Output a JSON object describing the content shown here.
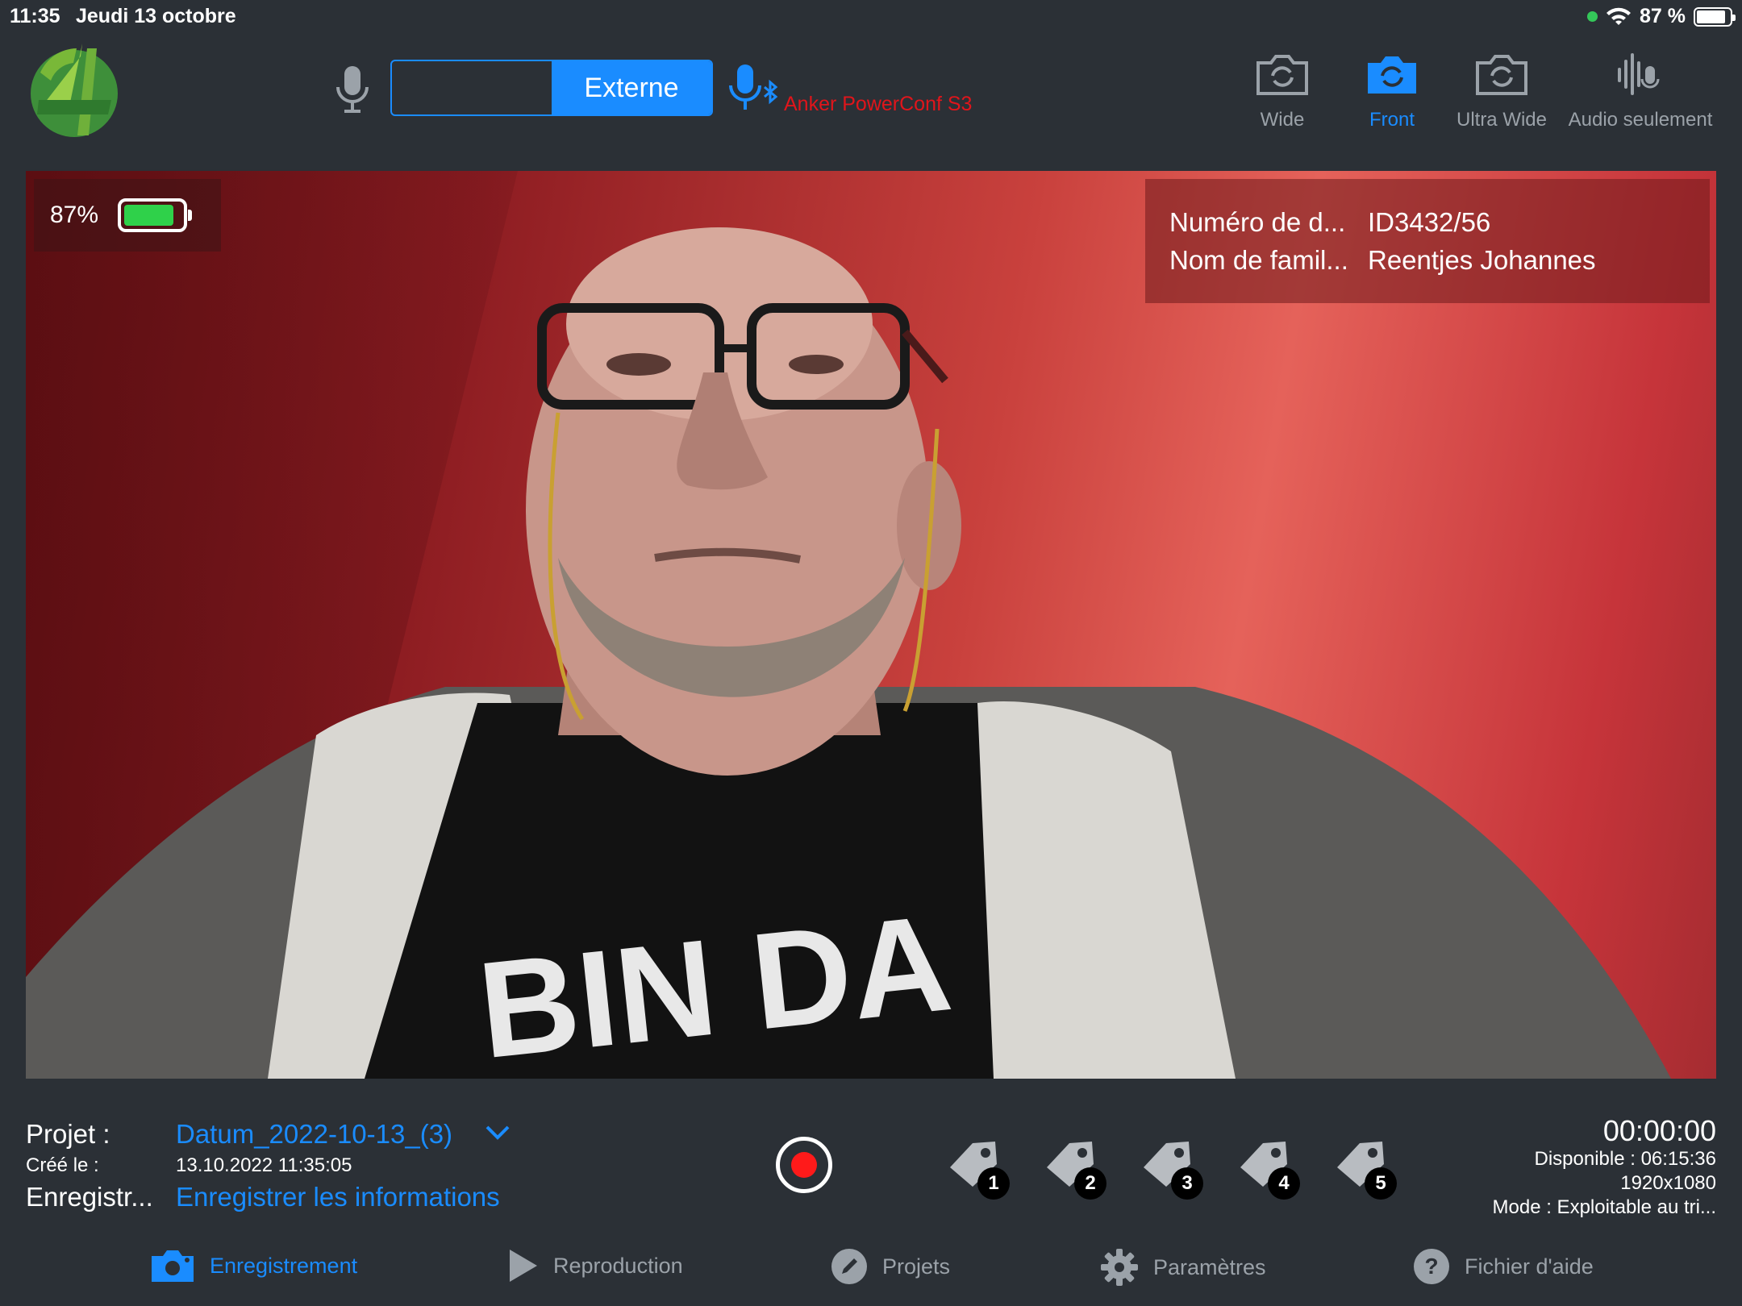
{
  "status_bar": {
    "time": "11:35",
    "date": "Jeudi 13 octobre",
    "battery_text": "87 %"
  },
  "toolbar": {
    "audio_source": {
      "options": [
        "",
        "Externe"
      ],
      "selected": "Externe"
    },
    "external_device": "Anker PowerConf S3",
    "cameras": [
      {
        "label": "Wide",
        "active": false
      },
      {
        "label": "Front",
        "active": true
      },
      {
        "label": "Ultra Wide",
        "active": false
      },
      {
        "label": "Audio seulement",
        "active": false
      }
    ]
  },
  "preview": {
    "battery_percent": "87%",
    "battery_level": 0.87,
    "info": [
      {
        "key": "Numéro de d...",
        "value": "ID3432/56"
      },
      {
        "key": "Nom de famil...",
        "value": "Reentjes Johannes"
      }
    ],
    "shirt_text": "BIN DA"
  },
  "project": {
    "label": "Projet :",
    "name": "Datum_2022-10-13_(3)",
    "created_label": "Créé le :",
    "created_value": "13.10.2022 11:35:05",
    "record_label": "Enregistr...",
    "record_link": "Enregistrer les informations"
  },
  "tags": [
    "1",
    "2",
    "3",
    "4",
    "5"
  ],
  "recording": {
    "timer": "00:00:00",
    "available": "Disponible : 06:15:36",
    "resolution": "1920x1080",
    "mode": "Mode : Exploitable au tri..."
  },
  "tabs": [
    {
      "label": "Enregistrement",
      "icon": "camera-icon",
      "active": true
    },
    {
      "label": "Reproduction",
      "icon": "play-icon",
      "active": false
    },
    {
      "label": "Projets",
      "icon": "pencil-icon",
      "active": false
    },
    {
      "label": "Paramètres",
      "icon": "gear-icon",
      "active": false
    },
    {
      "label": "Fichier d'aide",
      "icon": "help-icon",
      "active": false
    }
  ],
  "colors": {
    "accent": "#1a8cff",
    "background": "#2b3036",
    "device_name": "#e0151b",
    "record": "#ff1a1a",
    "battery_fill": "#2fd14a"
  }
}
